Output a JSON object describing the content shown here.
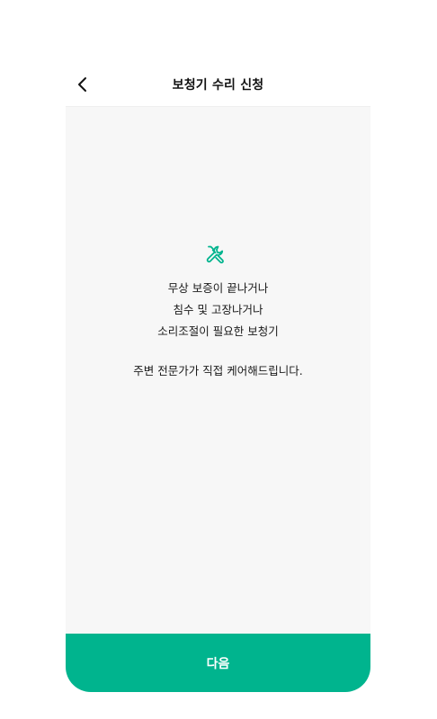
{
  "header": {
    "title": "보청기 수리 신청",
    "back_icon": "chevron-left-icon"
  },
  "main": {
    "icon": "tools-icon",
    "lines": [
      "무상 보증이 끝나거나",
      "침수 및 고장나거나",
      "소리조절이 필요한 보청기"
    ],
    "sub": "주변 전문가가 직접 케어해드립니다."
  },
  "footer": {
    "next_label": "다음"
  },
  "colors": {
    "accent": "#00b48e",
    "content_bg": "#f7f7f7"
  }
}
